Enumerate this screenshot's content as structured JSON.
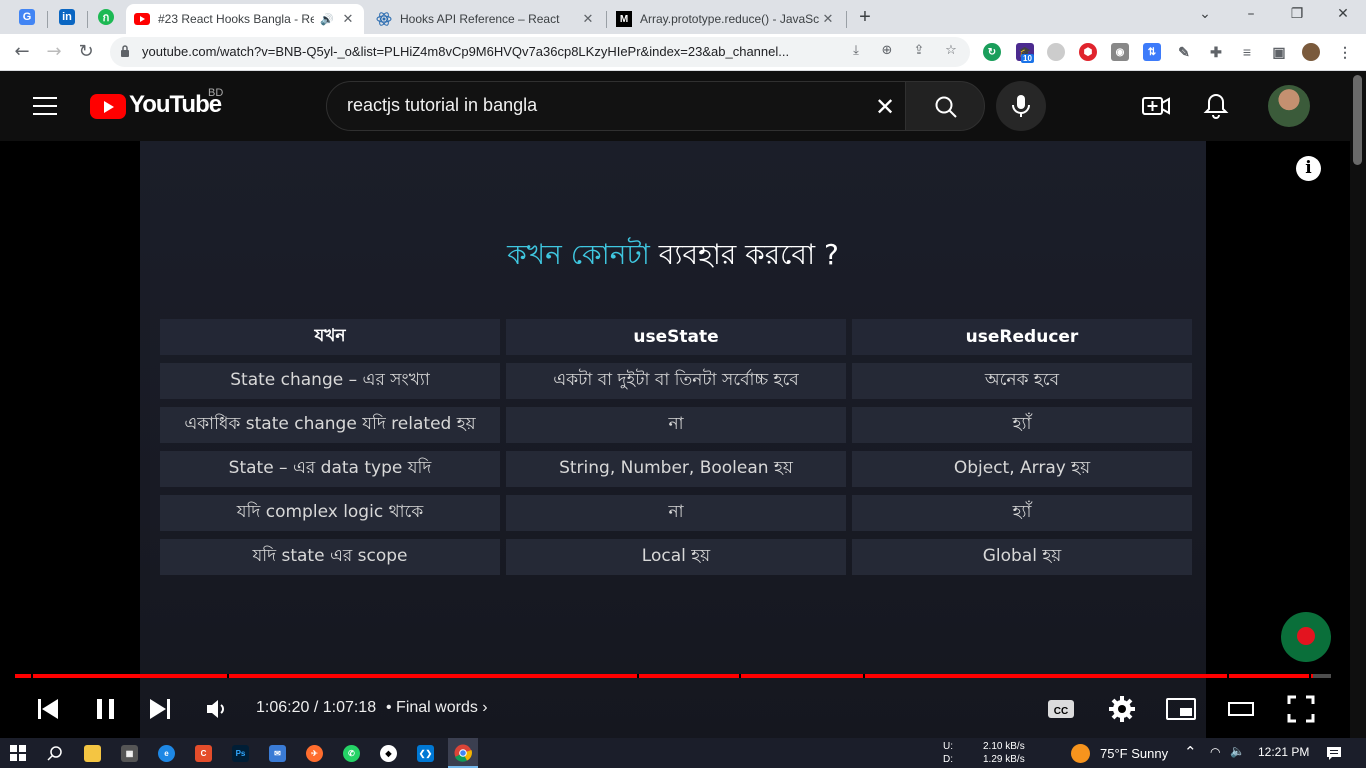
{
  "browser": {
    "tabs": [
      {
        "title": "#23 React Hooks Bangla - Re",
        "active": true,
        "audio_icon": "speaker-icon"
      },
      {
        "title": "Hooks API Reference – React",
        "active": false
      },
      {
        "title": "Array.prototype.reduce() - JavaSc",
        "active": false
      }
    ],
    "url": "youtube.com/watch?v=BNB-Q5yl-_o&list=PLHiZ4m8vCp9M6HVQv7a36cp8LKzyHIePr&index=23&ab_channel...",
    "extension_badge": "10"
  },
  "youtube": {
    "logo_text": "YouTube",
    "country_code": "BD",
    "search_query": "reactjs tutorial in bangla"
  },
  "slide": {
    "title_highlight": "কখন কোনটা",
    "title_rest": " ব্যবহার করবো ?",
    "table": {
      "headers": [
        "যখন",
        "useState",
        "useReducer"
      ],
      "rows": [
        [
          "State change – এর সংখ্যা",
          "একটা বা দুইটা বা তিনটা সর্বোচ্চ হবে",
          "অনেক হবে"
        ],
        [
          "একাধিক state change  যদি related হয়",
          "না",
          "হ্যাঁ"
        ],
        [
          "State – এর data type যদি",
          "String, Number, Boolean হয়",
          "Object, Array হয়"
        ],
        [
          "যদি complex logic থাকে",
          "না",
          "হ্যাঁ"
        ],
        [
          "যদি state এর scope",
          "Local হয়",
          "Global হয়"
        ]
      ]
    }
  },
  "player": {
    "current_time": "1:06:20",
    "duration": "1:07:18",
    "time_display": "1:06:20 / 1:07:18",
    "chapter": "Final words",
    "progress_fraction": 0.986
  },
  "taskbar": {
    "net_up_label": "U:",
    "net_down_label": "D:",
    "net_up": "2.10 kB/s",
    "net_down": "1.29 kB/s",
    "weather": "75°F  Sunny",
    "clock": "12:21 PM"
  },
  "colors": {
    "accent_red": "#ff0000",
    "slide_highlight": "#3fc7e0"
  }
}
